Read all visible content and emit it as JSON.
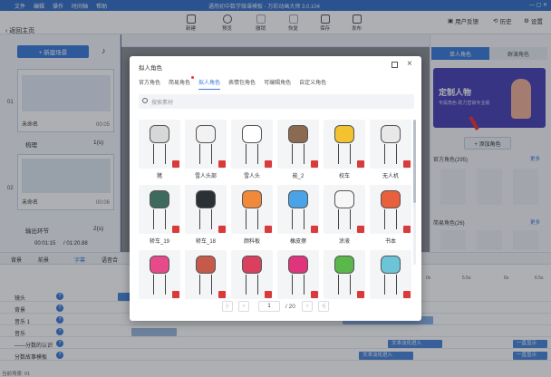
{
  "titlebar": {
    "menu": [
      "文件",
      "编辑",
      "操作",
      "时间轴",
      "帮助"
    ],
    "app_title": "通用初中数学微课模板 - 万彩动画大师 3.0.104"
  },
  "toolbar": {
    "home": "返回主页",
    "buttons": [
      "新建",
      "预览",
      "撤销",
      "恢复",
      "保存",
      "发布"
    ],
    "feedback": "用户反馈",
    "history": "历史",
    "settings": "设置"
  },
  "left": {
    "new_scene": "+ 新建场景",
    "scenes": [
      {
        "num": "01",
        "name": "未命名",
        "time": "00:05",
        "label": "梳理",
        "dur": "1(s)"
      },
      {
        "num": "02",
        "name": "未命名",
        "time": "00:06",
        "label": "输出环节",
        "dur": "2(s)"
      }
    ],
    "time_current": "00:01:15",
    "time_total": "/ 01:20.88"
  },
  "right": {
    "tabs": [
      "单人角色",
      "群演角色"
    ],
    "banner_title": "定制人物",
    "banner_sub": "专属角色 助力营销专业版",
    "add_role": "+ 添加角色",
    "section1": "官方角色(295)",
    "section2": "简易角色(26)",
    "more": "更多"
  },
  "dialog": {
    "title": "拟人角色",
    "tabs": [
      "官方角色",
      "简易角色",
      "拟人角色",
      "表情包角色",
      "可编辑角色",
      "自定义角色"
    ],
    "active_tab": 2,
    "search_placeholder": "搜索素材",
    "items": [
      {
        "label": "猪",
        "color": "#d7d7d7"
      },
      {
        "label": "雪人头部",
        "color": "#f2f2f2"
      },
      {
        "label": "雪人头",
        "color": "#ffffff"
      },
      {
        "label": "能_2",
        "color": "#8b6a52"
      },
      {
        "label": "校车",
        "color": "#f2c230"
      },
      {
        "label": "无人机",
        "color": "#e8e8e8"
      },
      {
        "label": "轿车_19",
        "color": "#3e6a5e"
      },
      {
        "label": "轿车_18",
        "color": "#2b2f36"
      },
      {
        "label": "颜料板",
        "color": "#f08a3a"
      },
      {
        "label": "橡皮擦",
        "color": "#4aa3e6"
      },
      {
        "label": "涂液",
        "color": "#f7f7f7"
      },
      {
        "label": "书本",
        "color": "#e8603c"
      },
      {
        "label": "",
        "color": "#e64a8a"
      },
      {
        "label": "",
        "color": "#c65a4a"
      },
      {
        "label": "",
        "color": "#d94060"
      },
      {
        "label": "",
        "color": "#e0347c"
      },
      {
        "label": "",
        "color": "#5ab84a"
      },
      {
        "label": "",
        "color": "#6cc4d8"
      }
    ],
    "page": "1",
    "total_pages": "/ 20"
  },
  "timeline": {
    "tabs": [
      "背景",
      "前景",
      "字幕",
      "语音合"
    ],
    "ruler": [
      "0s",
      "5.5s",
      "6s",
      "6.5s"
    ],
    "tracks": [
      {
        "name": "镜头"
      },
      {
        "name": "背景"
      },
      {
        "name": "音乐 1"
      },
      {
        "name": "音乐"
      },
      {
        "name": "——分数的认识"
      },
      {
        "name": "分数故事模板"
      }
    ],
    "clips": [
      "文本淡化进入",
      "文本淡化进入",
      "一直显示",
      "一直显示",
      "一直显示"
    ],
    "footer": "当前场景: 01"
  }
}
